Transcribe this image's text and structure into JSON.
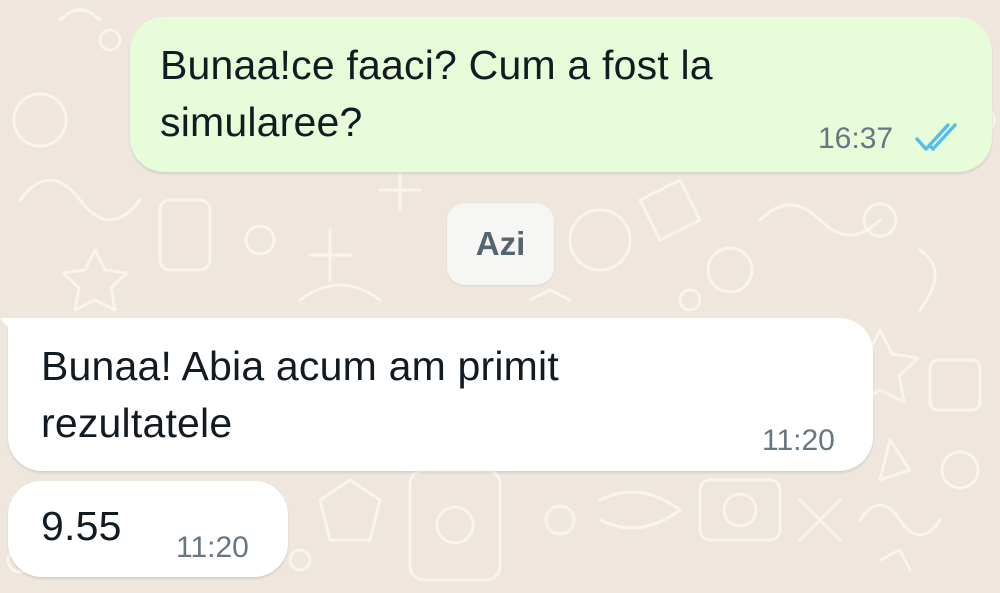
{
  "conversation": {
    "messages": [
      {
        "direction": "outgoing",
        "text": "Bunaa!ce faaci? Cum a fost la\nsimularee?",
        "time": "16:37",
        "status_icon": "double-check-read-icon"
      },
      {
        "direction": "incoming",
        "text": "Bunaa! Abia acum am primit\nrezultatele",
        "time": "11:20"
      },
      {
        "direction": "incoming",
        "text": "9.55",
        "time": "11:20"
      }
    ],
    "date_separator": "Azi"
  },
  "colors": {
    "wallpaper": "#efe7de",
    "outgoing_bubble": "#e7fcd8",
    "incoming_bubble": "#ffffff",
    "read_ticks": "#53bdeb",
    "time_text": "#667781"
  }
}
